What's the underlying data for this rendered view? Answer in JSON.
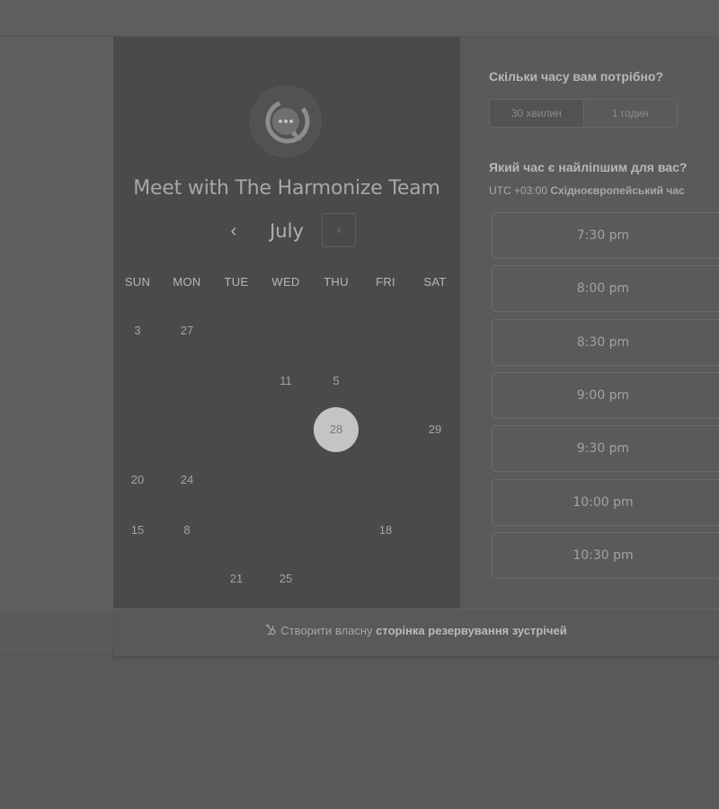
{
  "calendar": {
    "title": "Meet with The Harmonize Team",
    "month": "July",
    "prev_symbol": "‹",
    "next_symbol": "›",
    "weekdays": [
      "SUN",
      "MON",
      "TUE",
      "WED",
      "THU",
      "FRI",
      "SAT"
    ],
    "selected_day": "28",
    "days": [
      {
        "label": "3",
        "col": 0,
        "row": 0
      },
      {
        "label": "27",
        "col": 1,
        "row": 0
      },
      {
        "label": "11",
        "col": 3,
        "row": 1
      },
      {
        "label": "5",
        "col": 4,
        "row": 1
      },
      {
        "label": "28",
        "col": 4,
        "row": 2
      },
      {
        "label": "29",
        "col": 6,
        "row": 2
      },
      {
        "label": "20",
        "col": 0,
        "row": 3
      },
      {
        "label": "24",
        "col": 1,
        "row": 3
      },
      {
        "label": "15",
        "col": 0,
        "row": 4
      },
      {
        "label": "8",
        "col": 1,
        "row": 4
      },
      {
        "label": "18",
        "col": 5,
        "row": 4
      },
      {
        "label": "21",
        "col": 2,
        "row": 5
      },
      {
        "label": "25",
        "col": 3,
        "row": 5
      }
    ]
  },
  "scheduler": {
    "duration_question": "Скільки часу вам потрібно?",
    "durations": [
      "30 хвилин",
      "1 годин"
    ],
    "time_question": "Який час є найліпшим для вас?",
    "timezone_offset": "UTC +03:00",
    "timezone_name": "Східноєвропейський час",
    "slots": [
      "7:30 pm",
      "8:00 pm",
      "8:30 pm",
      "9:00 pm",
      "9:30 pm",
      "10:00 pm",
      "10:30 pm"
    ]
  },
  "footer": {
    "prefix": "Створити власну",
    "link": "сторінка резервування зустрічей"
  },
  "colors": {
    "selected_day_bg": "#c4c4c4",
    "left_panel_bg": "#4a4a4a"
  }
}
